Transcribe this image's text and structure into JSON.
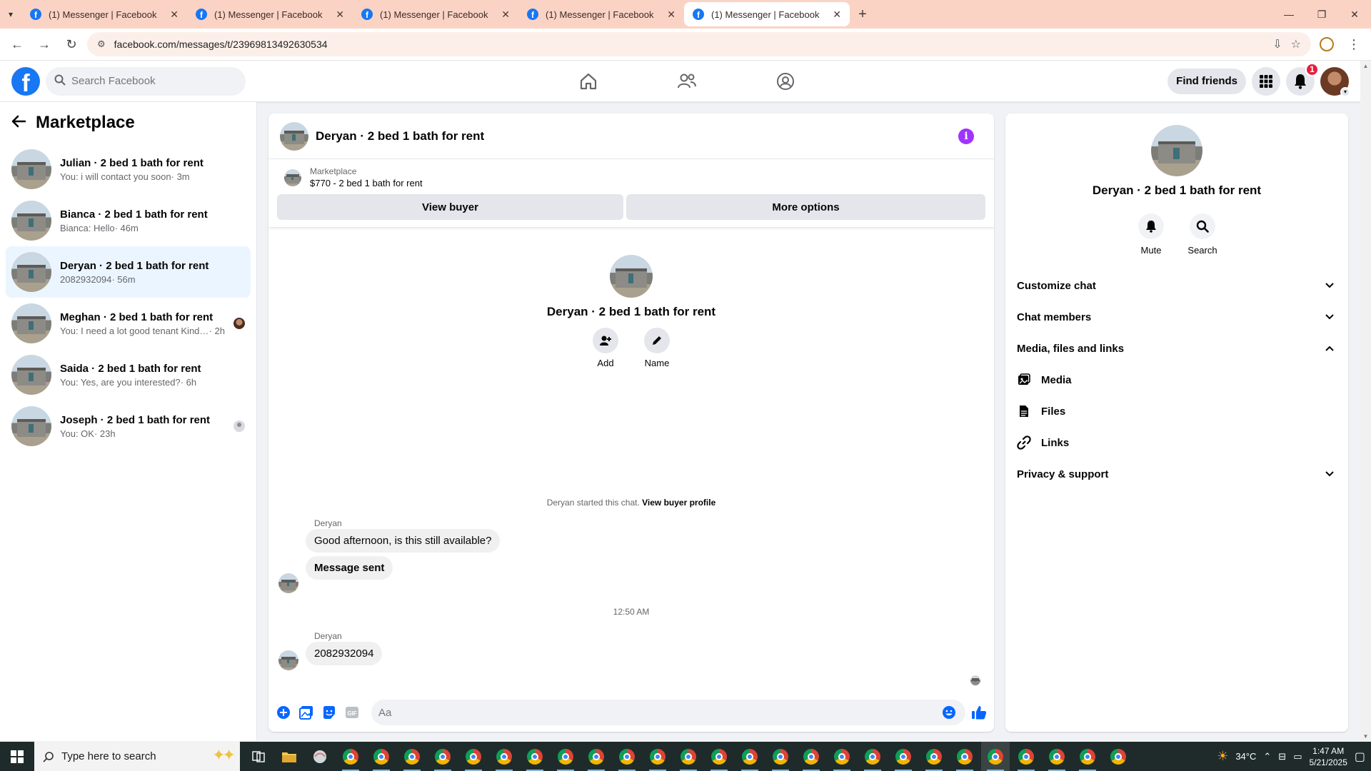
{
  "browser": {
    "tabs": [
      {
        "title": "(1) Messenger | Facebook",
        "active": false
      },
      {
        "title": "(1) Messenger | Facebook",
        "active": false
      },
      {
        "title": "(1) Messenger | Facebook",
        "active": false
      },
      {
        "title": "(1) Messenger | Facebook",
        "active": false
      },
      {
        "title": "(1) Messenger | Facebook",
        "active": true
      }
    ],
    "url": "facebook.com/messages/t/23969813492630534",
    "new_tab_icon": "plus-icon"
  },
  "topbar": {
    "logo_letter": "f",
    "search_placeholder": "Search Facebook",
    "find_friends_label": "Find friends",
    "notification_count": "1"
  },
  "sidebar": {
    "title": "Marketplace",
    "conversations": [
      {
        "title": "Julian · 2 bed 1 bath for rent",
        "preview": "You: i will contact you soon",
        "time": " · 3m",
        "active": false,
        "seen": ""
      },
      {
        "title": "Bianca · 2 bed 1 bath for rent",
        "preview": "Bianca: Hello",
        "time": " · 46m",
        "active": false,
        "seen": ""
      },
      {
        "title": "Deryan · 2 bed 1 bath for rent",
        "preview": "2082932094",
        "time": " · 56m",
        "active": true,
        "seen": ""
      },
      {
        "title": "Meghan · 2 bed 1 bath for rent",
        "preview": "You: I need a lot good tenant Kindl...",
        "time": " · 2h",
        "active": false,
        "seen": "photo"
      },
      {
        "title": "Saida · 2 bed 1 bath for rent",
        "preview": "You: Yes, are you interested?",
        "time": " · 6h",
        "active": false,
        "seen": ""
      },
      {
        "title": "Joseph · 2 bed 1 bath for rent",
        "preview": "You: OK",
        "time": " · 23h",
        "active": false,
        "seen": "default"
      }
    ]
  },
  "chat": {
    "title": "Deryan · 2 bed 1 bath for rent",
    "listing_label": "Marketplace",
    "listing_price": "$770 - 2 bed 1 bath for rent",
    "view_buyer_label": "View buyer",
    "more_options_label": "More options",
    "intro_name": "Deryan · 2 bed 1 bath for rent",
    "add_label": "Add",
    "name_label": "Name",
    "system_text": "Deryan started this chat.",
    "system_link": "View buyer profile",
    "sender1": "Deryan",
    "msg1": "Good afternoon, is this still available?",
    "msg2": "Message sent",
    "timestamp": "12:50 AM",
    "sender2": "Deryan",
    "msg3": "2082932094",
    "composer_placeholder": "Aa"
  },
  "info_panel": {
    "name": "Deryan · 2 bed 1 bath for rent",
    "mute_label": "Mute",
    "search_label": "Search",
    "sections": [
      "Customize chat",
      "Chat members",
      "Media, files and links"
    ],
    "sub_items": [
      "Media",
      "Files",
      "Links"
    ],
    "privacy_label": "Privacy & support"
  },
  "taskbar": {
    "search_placeholder": "Type here to search",
    "temperature": "34°C",
    "time": "1:47 AM",
    "date": "5/21/2025"
  },
  "colors": {
    "facebook_blue": "#1877f2",
    "messenger_purple": "#a033ff",
    "notification_red": "#e41e3f",
    "tabstrip": "#fbd3c5"
  }
}
